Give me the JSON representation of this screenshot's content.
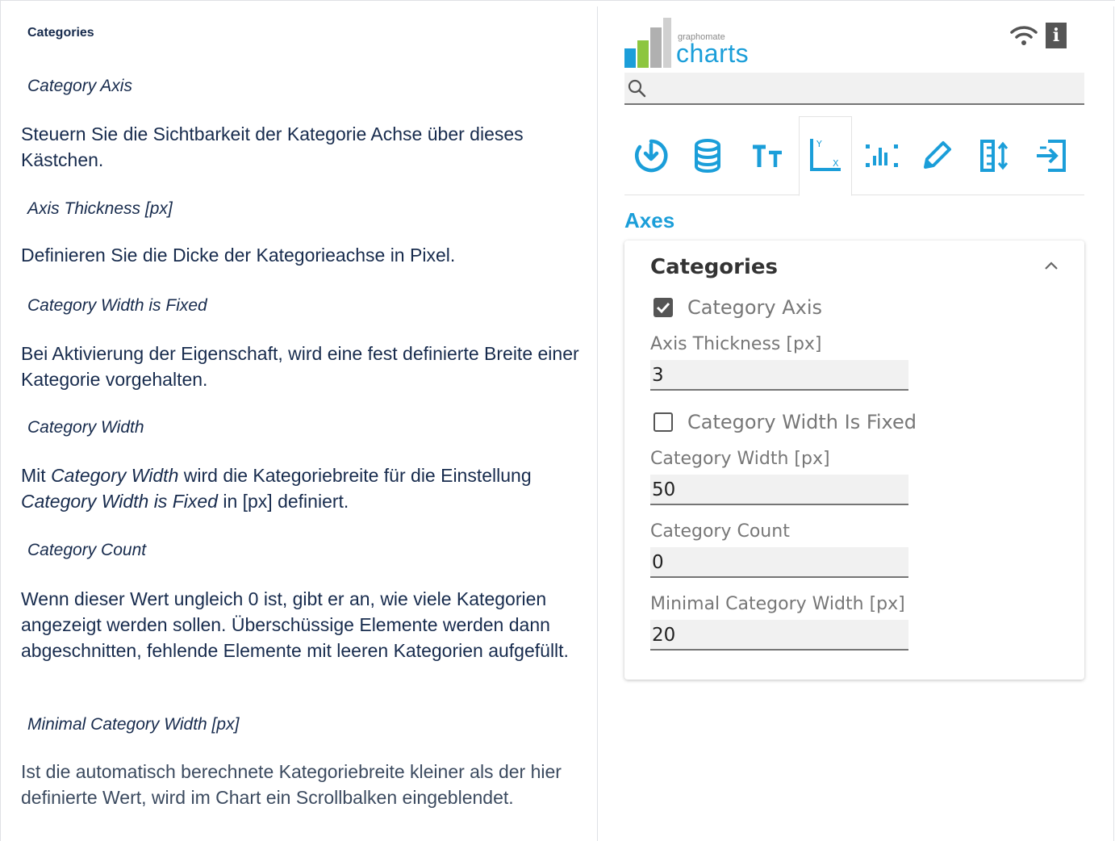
{
  "doc": {
    "heading": "Categories",
    "sections": [
      {
        "label": "Category Axis",
        "text": "Steuern Sie die Sichtbarkeit der Kategorie Achse über dieses Kästchen."
      },
      {
        "label": "Axis Thickness [px]",
        "text": "Definieren Sie die Dicke der Kategorieachse in Pixel."
      },
      {
        "label": "Category Width is Fixed",
        "text": "Bei Aktivierung der Eigenschaft, wird eine fest definierte Breite einer Kategorie vorgehalten."
      },
      {
        "label": "Category Width",
        "text_parts": [
          "Mit ",
          "Category Width",
          " wird die Kategoriebreite für die Einstellung ",
          "Category Width is Fixed",
          " in [px] definiert."
        ]
      },
      {
        "label": "Category Count",
        "text": "Wenn dieser Wert ungleich 0 ist, gibt er an, wie viele Kategorien angezeigt werden sollen. Überschüssige Elemente werden dann abgeschnitten, fehlende Elemente mit leeren Kategorien aufgefüllt."
      },
      {
        "label": "Minimal Category Width [px]",
        "text": "Ist die automatisch berechnete Kategoriebreite kleiner als der hier definierte Wert, wird im Chart ein Scrollbalken eingeblendet."
      }
    ]
  },
  "panel": {
    "logo_small": "graphomate",
    "logo_big": "charts",
    "info_label": "i",
    "search_placeholder": "",
    "tabs": [
      {
        "icon": "general-settings-icon",
        "active": false
      },
      {
        "icon": "database-icon",
        "active": false
      },
      {
        "icon": "text-size-icon",
        "active": false
      },
      {
        "icon": "axes-icon",
        "active": true
      },
      {
        "icon": "data-points-icon",
        "active": false
      },
      {
        "icon": "pencil-icon",
        "active": false
      },
      {
        "icon": "ruler-sort-icon",
        "active": false
      },
      {
        "icon": "export-icon",
        "active": false
      }
    ],
    "section_title": "Axes",
    "card": {
      "title": "Categories",
      "category_axis": {
        "label": "Category Axis",
        "checked": true
      },
      "axis_thickness": {
        "label": "Axis Thickness [px]",
        "value": "3"
      },
      "width_fixed": {
        "label": "Category Width Is Fixed",
        "checked": false
      },
      "category_width": {
        "label": "Category Width [px]",
        "value": "50"
      },
      "category_count": {
        "label": "Category Count",
        "value": "0"
      },
      "min_category_width": {
        "label": "Minimal Category Width [px]",
        "value": "20"
      }
    }
  },
  "colors": {
    "accent": "#1b9ed9",
    "logo_green": "#8dc63f",
    "logo_gray": "#b0b0b0"
  }
}
